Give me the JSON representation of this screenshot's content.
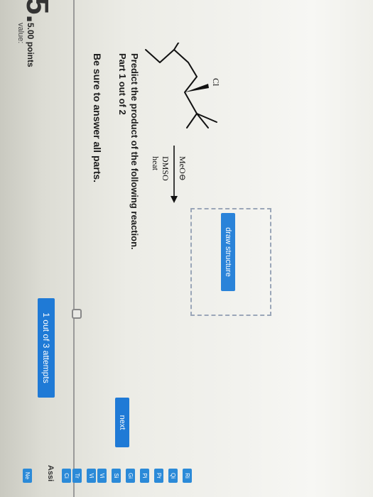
{
  "question": {
    "number": "5.",
    "value_label": "value:",
    "points": "5.00 points"
  },
  "attempts_label": "1 out of 3 attempts",
  "instructions": "Be sure to answer all parts.",
  "part_label": "Part 1 out of 2",
  "prompt": "Predict the product of the following reaction.",
  "reaction": {
    "substituent_label": "Cl",
    "reagent": "MeO",
    "reagent_charge": "⊖",
    "solvent": "DMSO",
    "condition": "heat"
  },
  "buttons": {
    "draw_structure": "draw structure",
    "next": "next"
  },
  "sidebar": {
    "header": "Assi",
    "top_tab": "Ne",
    "tabs": [
      "Ci",
      "Tr",
      "Vi",
      "Vi",
      "Si",
      "Gi",
      "Pi",
      "Pr",
      "Qi",
      "Ri"
    ]
  },
  "colors": {
    "accent": "#1f7ad6",
    "dash_border": "#9aa6b8"
  }
}
